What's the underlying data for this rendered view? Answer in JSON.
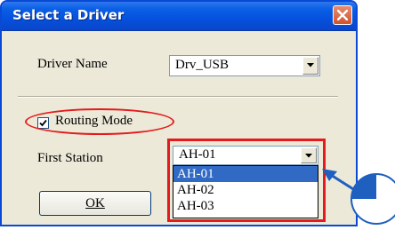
{
  "window": {
    "title": "Select a Driver"
  },
  "form": {
    "driver_name_label": "Driver Name",
    "driver_name_value": "Drv_USB",
    "routing_mode_label": "Routing Mode",
    "routing_mode_checked": true,
    "first_station_label": "First Station",
    "first_station_value": "AH-01",
    "first_station_options": [
      "AH-01",
      "AH-02",
      "AH-03"
    ],
    "first_station_selected_index": 0
  },
  "buttons": {
    "ok_label": "OK"
  },
  "colors": {
    "highlight": "#e41a1c",
    "selection": "#316ac5",
    "pointer": "#1f5fbf"
  }
}
